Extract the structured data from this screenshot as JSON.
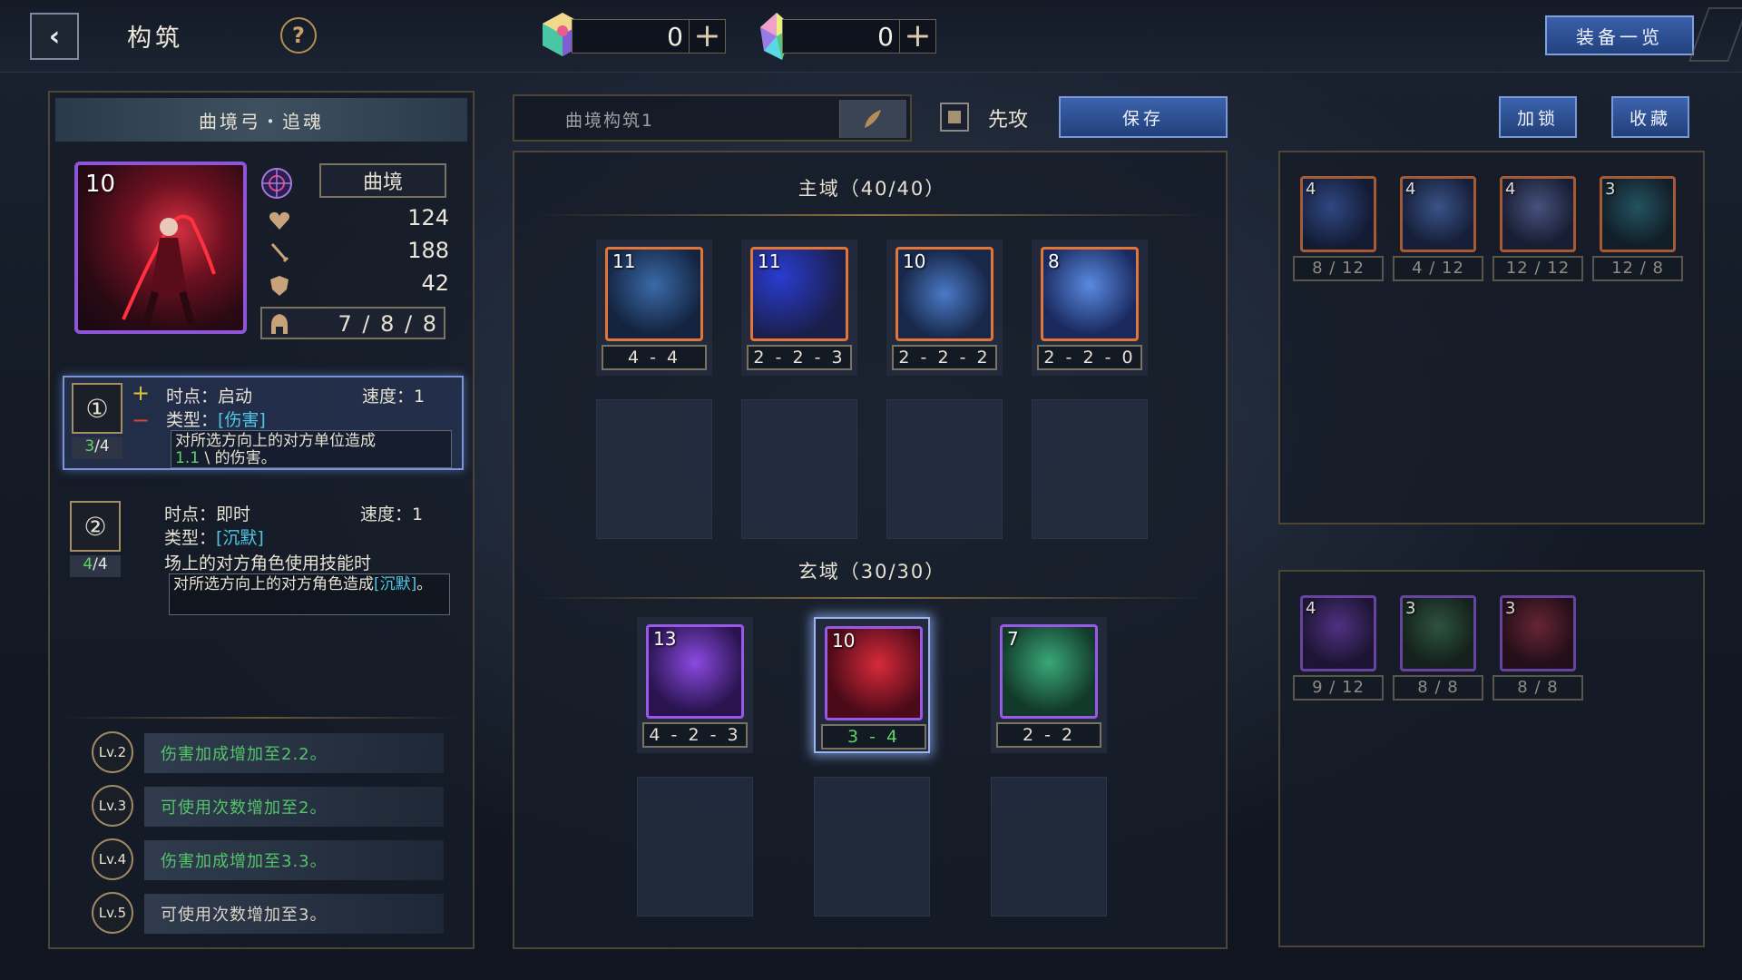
{
  "header": {
    "title": "构筑",
    "back_icon": "‹",
    "help_icon": "?",
    "currency1": {
      "value": "0",
      "icon": "cube-gem-icon"
    },
    "currency2": {
      "value": "0",
      "icon": "crystal-icon"
    },
    "plus": "+",
    "equip_list": "装备一览"
  },
  "hero": {
    "name": "曲境弓・追魂",
    "level": "10",
    "type": "曲境",
    "hp": "124",
    "attack": "188",
    "defense": "42",
    "cost": "7 / 8 / 8"
  },
  "skills": [
    {
      "num": "①",
      "uses_current": "3",
      "uses_total": "/4",
      "timing": "时点：启动",
      "speed": "速度：1",
      "type_prefix": "类型：",
      "type_tag": "[伤害]",
      "desc_a": "对所选方向上的对方单位造成",
      "desc_value": "1.1",
      "desc_b": "的伤害。",
      "plus": "+",
      "minus": "−"
    },
    {
      "num": "②",
      "uses_current": "4",
      "uses_total": "/4",
      "timing": "时点：即时",
      "speed": "速度：1",
      "type_prefix": "类型：",
      "type_tag": "[沉默]",
      "condition": "场上的对方角色使用技能时",
      "desc_a": "对所选方向上的对方角色造成",
      "desc_tag": "[沉默]",
      "desc_b": "。"
    }
  ],
  "levels": [
    {
      "lv": "Lv.2",
      "text": "伤害加成增加至2.2。"
    },
    {
      "lv": "Lv.3",
      "text": "可使用次数增加至2。"
    },
    {
      "lv": "Lv.4",
      "text": "伤害加成增加至3.3。"
    },
    {
      "lv": "Lv.5",
      "text": "可使用次数增加至3。"
    }
  ],
  "deck": {
    "name_placeholder": "曲境构筑1",
    "first_attack": "先攻",
    "save": "保存",
    "lock": "加锁",
    "favorite": "收藏",
    "main_zone_title": "主域（40/40）",
    "mystic_zone_title": "玄域（30/30）",
    "main_cards": [
      {
        "lvl": "11",
        "stats": "4 - 4"
      },
      {
        "lvl": "11",
        "stats": "2 - 2 - 3"
      },
      {
        "lvl": "10",
        "stats": "2 - 2 - 2"
      },
      {
        "lvl": "8",
        "stats": "2 - 2 - 0"
      }
    ],
    "mystic_cards": [
      {
        "lvl": "13",
        "stats": "4 - 2 - 3"
      },
      {
        "lvl": "10",
        "stats": "3 - 4"
      },
      {
        "lvl": "7",
        "stats": "2 - 2"
      }
    ]
  },
  "pool_main": [
    {
      "lvl": "4",
      "stats": "8 / 12"
    },
    {
      "lvl": "4",
      "stats": "4 / 12"
    },
    {
      "lvl": "4",
      "stats": "12 / 12"
    },
    {
      "lvl": "3",
      "stats": "12 / 8"
    }
  ],
  "pool_mystic": [
    {
      "lvl": "4",
      "stats": "9 / 12"
    },
    {
      "lvl": "3",
      "stats": "8 / 8"
    },
    {
      "lvl": "3",
      "stats": "8 / 8"
    }
  ]
}
